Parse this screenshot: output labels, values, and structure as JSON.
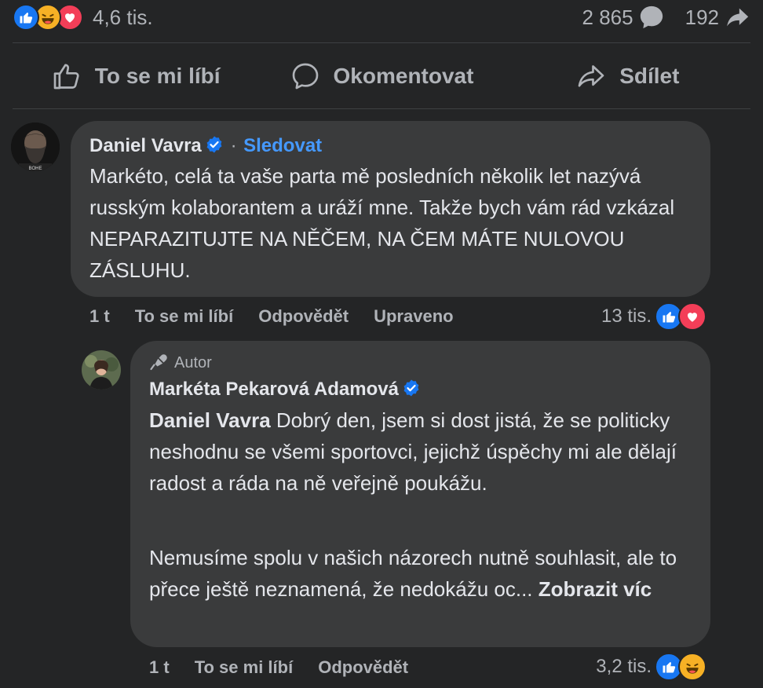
{
  "post_stats": {
    "reactions_count": "4,6 tis.",
    "comments_count": "2 865",
    "shares_count": "192",
    "reaction_icons": [
      "like-icon",
      "haha-icon",
      "love-icon"
    ]
  },
  "actions": {
    "like_label": "To se mi líbí",
    "comment_label": "Okomentovat",
    "share_label": "Sdílet"
  },
  "comments": [
    {
      "author": "Daniel Vavra",
      "verified": true,
      "separator": "·",
      "follow_label": "Sledovat",
      "text": "Markéto, celá ta vaše parta mě posledních několik let nazývá rusským kolaborantem a uráží mne. Takže bych vám rád vzkázal NEPARAZITUJTE NA NĚČEM, NA ČEM MÁTE NULOVOU ZÁSLUHU.",
      "time": "1 t",
      "like_label": "To se mi líbí",
      "reply_label": "Odpovědět",
      "edited_label": "Upraveno",
      "reaction_count": "13 tis."
    }
  ],
  "reply": {
    "badge_label": "Autor",
    "author": "Markéta Pekarová Adamová",
    "verified": true,
    "mention": "Daniel Vavra",
    "text_p1": " Dobrý den, jsem si dost jistá, že se politicky neshodnu se všemi sportovci, jejichž úspěchy mi ale dělají radost a ráda na ně veřejně poukážu.",
    "text_p2": "Nemusíme spolu v našich názorech nutně souhlasit, ale to přece ještě neznamená, že nedokážu oc...",
    "see_more_label": "Zobrazit víc",
    "time": "1 t",
    "like_label": "To se mi líbí",
    "reply_label": "Odpovědět",
    "reaction_count": "3,2 tis."
  },
  "colors": {
    "background": "#242526",
    "bubble": "#3a3b3c",
    "link_blue": "#4599ff",
    "like_blue": "#1877f2",
    "love_red": "#f33e58",
    "haha_yellow": "#f7b125"
  }
}
